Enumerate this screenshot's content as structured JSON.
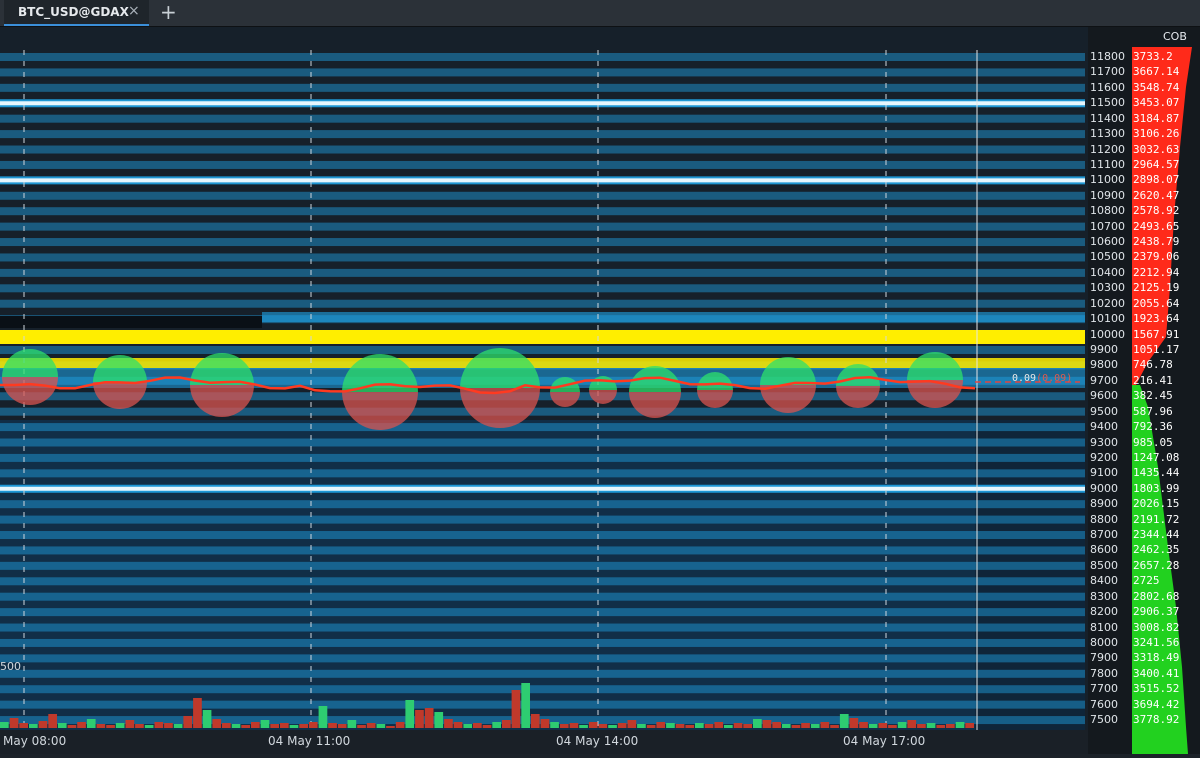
{
  "tab": {
    "title": "BTC_USD@GDAX",
    "close": "×",
    "add": "+"
  },
  "cob_header": "COB",
  "prices": [
    "11800",
    "11700",
    "11600",
    "11500",
    "11400",
    "11300",
    "11200",
    "11100",
    "11000",
    "10900",
    "10800",
    "10700",
    "10600",
    "10500",
    "10400",
    "10300",
    "10200",
    "10100",
    "10000",
    "9900",
    "9800",
    "9700",
    "9600",
    "9500",
    "9400",
    "9300",
    "9200",
    "9100",
    "9000",
    "8900",
    "8800",
    "8700",
    "8600",
    "8500",
    "8400",
    "8300",
    "8200",
    "8100",
    "8000",
    "7900",
    "7800",
    "7700",
    "7600",
    "7500"
  ],
  "cob_values": [
    "3733.2",
    "3667.14",
    "3548.74",
    "3453.07",
    "3184.87",
    "3106.26",
    "3032.63",
    "2964.57",
    "2898.07",
    "2620.47",
    "2578.92",
    "2493.65",
    "2438.79",
    "2379.06",
    "2212.94",
    "2125.19",
    "2055.64",
    "1923.64",
    "1567.91",
    "1051.17",
    "746.78",
    "216.41",
    "382.45",
    "587.96",
    "792.36",
    "985.05",
    "1247.08",
    "1435.44",
    "1803.99",
    "2026.15",
    "2191.72",
    "2344.44",
    "2462.35",
    "2657.28",
    "2725",
    "2802.68",
    "2906.37",
    "3008.82",
    "3241.56",
    "3318.49",
    "3400.41",
    "3515.52",
    "3694.42",
    "3778.92"
  ],
  "colors": {
    "ask": "#ff2a1a",
    "bid": "#22d11f",
    "heat_blue": "#1fa3e6",
    "heat_yellow": "#ffee00",
    "vol_up": "#2ecc71",
    "vol_down": "#c0392b"
  },
  "time_labels": [
    "May 08:00",
    "04 May 11:00",
    "04 May 14:00",
    "04 May 17:00"
  ],
  "axis_small_label": "500",
  "last_price": {
    "value": "0.09",
    "change": "(0.09)"
  }
}
